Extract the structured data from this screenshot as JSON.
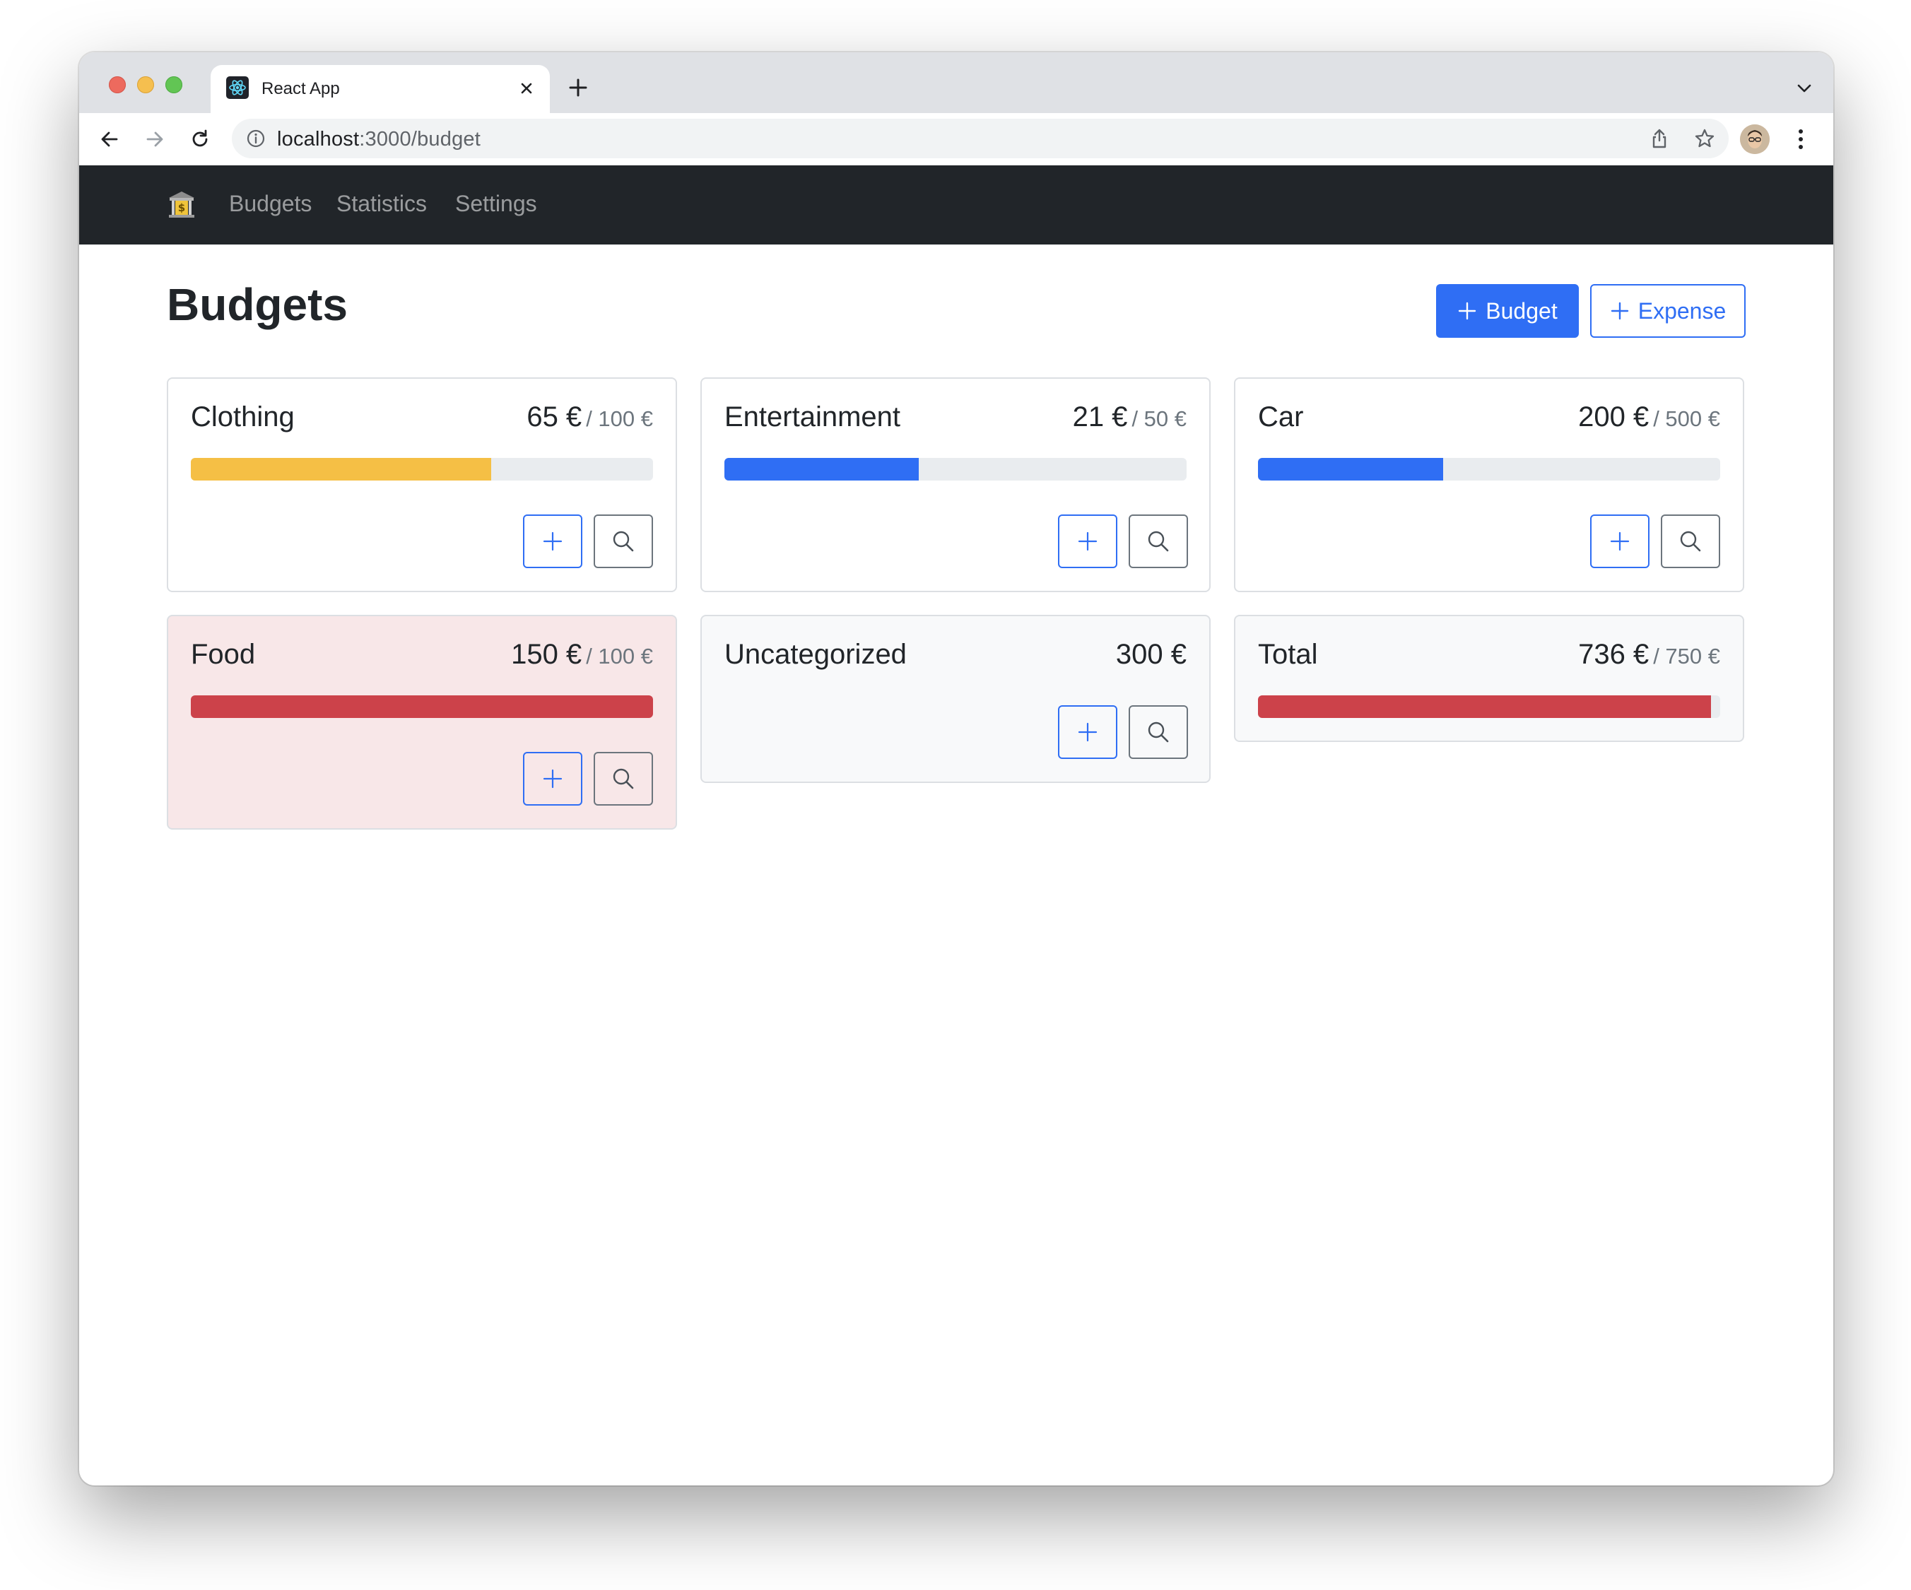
{
  "browser": {
    "tab_title": "React App",
    "url_host": "localhost",
    "url_path": ":3000/budget"
  },
  "navbar": {
    "brand_icon": "bank-icon",
    "links": [
      "Budgets",
      "Statistics",
      "Settings"
    ]
  },
  "page": {
    "title": "Budgets",
    "add_budget_label": "Budget",
    "add_expense_label": "Expense"
  },
  "colors": {
    "primary": "#2f6ef4",
    "warning": "#f5bf45",
    "danger": "#cc424a",
    "navbar": "#212529"
  },
  "budgets": [
    {
      "name": "Clothing",
      "amount": "65 €",
      "max": "/ 100 €",
      "progress": 0.65,
      "bar": "warning"
    },
    {
      "name": "Entertainment",
      "amount": "21 €",
      "max": "/ 50 €",
      "progress": 0.42,
      "bar": "primary"
    },
    {
      "name": "Car",
      "amount": "200 €",
      "max": "/ 500 €",
      "progress": 0.4,
      "bar": "primary"
    },
    {
      "name": "Food",
      "amount": "150 €",
      "max": "/ 100 €",
      "progress": 1.0,
      "bar": "danger"
    },
    {
      "name": "Uncategorized",
      "amount": "300 €"
    },
    {
      "name": "Total",
      "amount": "736 €",
      "max": "/ 750 €",
      "progress": 0.98,
      "bar": "danger"
    }
  ]
}
